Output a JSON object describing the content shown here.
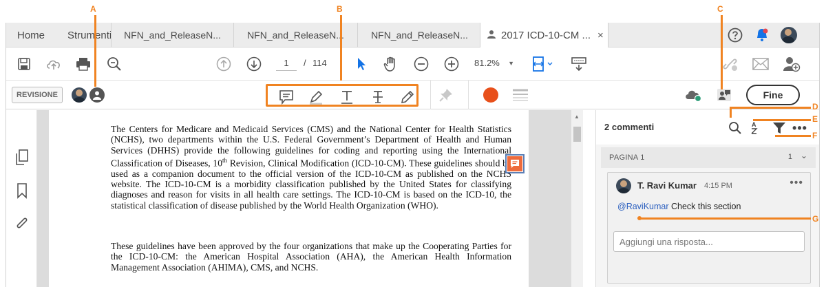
{
  "tabs": {
    "home": "Home",
    "tools": "Strumenti",
    "doc1": "NFN_and_ReleaseN...",
    "doc2": "NFN_and_ReleaseN...",
    "doc3": "NFN_and_ReleaseN...",
    "active": "2017 ICD-10-CM ...",
    "close": "×"
  },
  "toolbar": {
    "page_current": "1",
    "page_sep": "/",
    "page_total": "114",
    "zoom": "81.2%"
  },
  "review": {
    "label": "REVISIONE",
    "done": "Fine"
  },
  "document": {
    "para1_a": "The Centers for Medicare and Medicaid Services (CMS) and the National Center for Health Statistics (NCHS), two departments within the U.S. Federal Government’s Department of Health and Human Services (DHHS) provide the following guidelines for coding and reporting using the International Classification of Diseases, 10",
    "para1_sup": "th",
    "para1_b": " Revision, Clinical Modification (ICD-10-CM). These guidelines should be used as a companion document to the official version of the ICD-10-CM as published on the NCHS website. The ICD-10-CM is a morbidity classification published by the United States for classifying diagnoses and reason for visits in all health care settings.  The ICD-10-CM is based on the ICD-10, the statistical classification of disease published by the World Health Organization (WHO).",
    "para2": "These guidelines have been approved by the four organizations that make up the Cooperating Parties for the ICD-10-CM: the American Hospital Association (AHA), the American Health Information Management Association (AHIMA), CMS, and NCHS."
  },
  "comments": {
    "count_label": "2 commenti",
    "page_label": "PAGINA 1",
    "page_count": "1",
    "author": "T. Ravi Kumar",
    "time": "4:15 PM",
    "mention": "@RaviKumar",
    "text": " Check this section",
    "reply_placeholder": "Aggiungi una risposta..."
  },
  "annotations": [
    "A",
    "B",
    "C",
    "D",
    "E",
    "F",
    "G"
  ],
  "colors": {
    "annotation": "#f08321",
    "accent_blue": "#1473e6",
    "notification_red": "#e34850",
    "record_red": "#e8501b",
    "note_orange": "#ee6b3c"
  }
}
